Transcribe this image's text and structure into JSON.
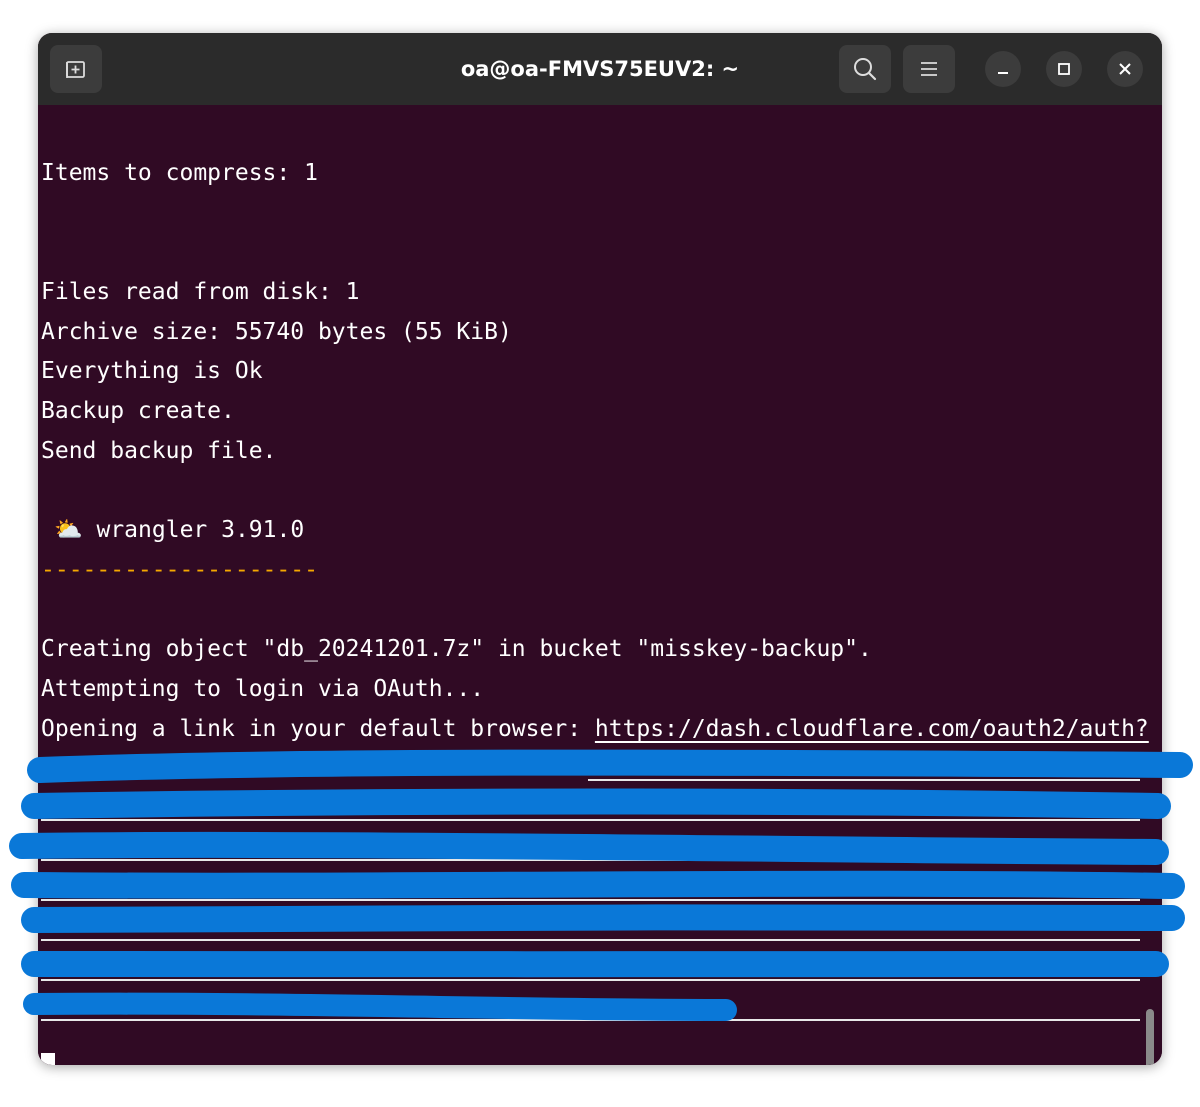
{
  "window": {
    "title": "oa@oa-FMVS75EUV2: ~"
  },
  "toolbar": {
    "new_tab_icon": "new-tab-icon",
    "search_icon": "search-icon",
    "menu_icon": "hamburger-menu-icon",
    "minimize_icon": "minimize-icon",
    "maximize_icon": "maximize-icon",
    "close_icon": "close-icon"
  },
  "terminal": {
    "lines": [
      "Items to compress: 1",
      "Files read from disk: 1",
      "Archive size: 55740 bytes (55 KiB)",
      "Everything is Ok",
      "Backup create.",
      "Send backup file.",
      "⛅️ wrangler 3.91.0",
      "--------------------",
      "Creating object \"db_20241201.7z\" in bucket \"misskey-backup\".",
      "Attempting to login via OAuth...",
      "Opening a link in your default browser: "
    ],
    "link": "https://dash.cloudflare.com/oauth2/auth?"
  },
  "colors": {
    "terminal_bg": "#300a24",
    "titlebar_bg": "#2b2b2b",
    "dashes": "#f5a800",
    "redaction": "#0a78d8"
  }
}
